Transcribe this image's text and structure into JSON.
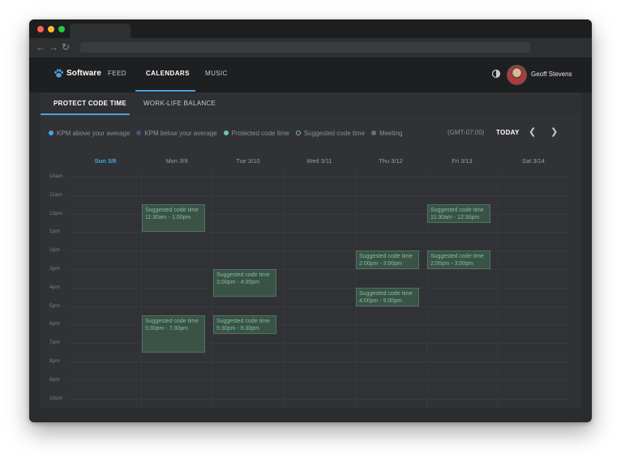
{
  "app": {
    "brand": "Software",
    "nav": [
      {
        "label": "FEED"
      },
      {
        "label": "CALENDARS",
        "active": true
      },
      {
        "label": "MUSIC"
      }
    ],
    "user": {
      "name": "Geoff Stevens"
    }
  },
  "tabs": [
    {
      "label": "PROTECT CODE TIME",
      "active": true
    },
    {
      "label": "WORK-LIFE BALANCE"
    }
  ],
  "legend": [
    {
      "label": "KPM above your average",
      "color": "#4aa3df",
      "icon": "filled-dot"
    },
    {
      "label": "KPM below your average",
      "color": "#3d5a80",
      "icon": "filled-dot"
    },
    {
      "label": "Protected code time",
      "color": "#6fc7a0",
      "icon": "filled-dot"
    },
    {
      "label": "Suggested code time",
      "color": "#6fc7a0",
      "icon": "ring-dot"
    },
    {
      "label": "Meeting",
      "color": "#6c6e73",
      "icon": "filled-dot"
    }
  ],
  "timezone": "(GMT-07:00)",
  "today_label": "TODAY",
  "days": [
    {
      "label": "Sun 3/8",
      "current": true
    },
    {
      "label": "Mon 3/9"
    },
    {
      "label": "Tue 3/10"
    },
    {
      "label": "Wed 3/11"
    },
    {
      "label": "Thu 3/12"
    },
    {
      "label": "Fri 3/13"
    },
    {
      "label": "Sat 3/14"
    }
  ],
  "hours": [
    "10am",
    "11am",
    "12pm",
    "1pm",
    "2pm",
    "3pm",
    "4pm",
    "5pm",
    "6pm",
    "7pm",
    "8pm",
    "9pm",
    "10pm"
  ],
  "events": [
    {
      "title": "Suggested code time",
      "time": "11:30am - 1:00pm",
      "day": 1,
      "start": 11.5,
      "end": 13.0
    },
    {
      "title": "Suggested code time",
      "time": "11:30am - 12:30pm",
      "day": 5,
      "start": 11.5,
      "end": 12.5
    },
    {
      "title": "Suggested code time",
      "time": "2:00pm - 3:00pm",
      "day": 4,
      "start": 14.0,
      "end": 15.0
    },
    {
      "title": "Suggested code time",
      "time": "2:00pm - 3:00pm",
      "day": 5,
      "start": 14.0,
      "end": 15.0
    },
    {
      "title": "Suggested code time",
      "time": "3:00pm - 4:30pm",
      "day": 2,
      "start": 15.0,
      "end": 16.5
    },
    {
      "title": "Suggested code time",
      "time": "4:00pm - 5:00pm",
      "day": 4,
      "start": 16.0,
      "end": 17.0
    },
    {
      "title": "Suggested code time",
      "time": "5:30pm - 7:30pm",
      "day": 1,
      "start": 17.5,
      "end": 19.5
    },
    {
      "title": "Suggested code time",
      "time": "5:30pm - 6:30pm",
      "day": 2,
      "start": 17.5,
      "end": 18.5
    }
  ],
  "colors": {
    "accent": "#4aa3df",
    "suggested_fill": "#3b5247",
    "suggested_text": "#7fc09c"
  }
}
